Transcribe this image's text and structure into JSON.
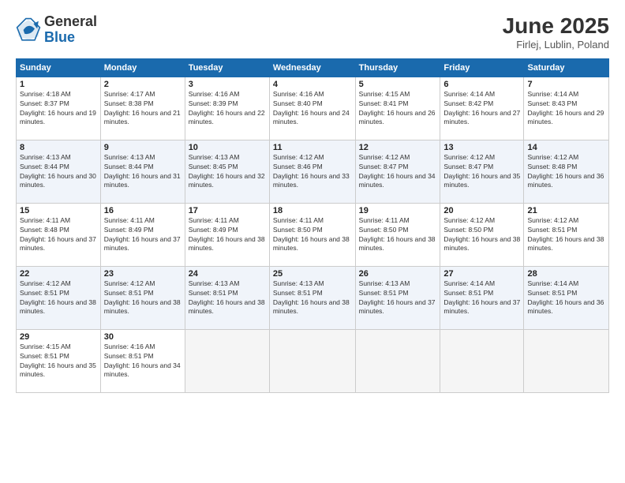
{
  "header": {
    "logo_general": "General",
    "logo_blue": "Blue",
    "title": "June 2025",
    "subtitle": "Firlej, Lublin, Poland"
  },
  "calendar": {
    "days_of_week": [
      "Sunday",
      "Monday",
      "Tuesday",
      "Wednesday",
      "Thursday",
      "Friday",
      "Saturday"
    ],
    "weeks": [
      [
        {
          "day": "",
          "empty": true
        },
        {
          "day": "",
          "empty": true
        },
        {
          "day": "",
          "empty": true
        },
        {
          "day": "",
          "empty": true
        },
        {
          "day": "",
          "empty": true
        },
        {
          "day": "",
          "empty": true
        },
        {
          "day": "",
          "empty": true
        }
      ],
      [
        {
          "day": "1",
          "sunrise": "4:18 AM",
          "sunset": "8:37 PM",
          "daylight": "16 hours and 19 minutes."
        },
        {
          "day": "2",
          "sunrise": "4:17 AM",
          "sunset": "8:38 PM",
          "daylight": "16 hours and 21 minutes."
        },
        {
          "day": "3",
          "sunrise": "4:16 AM",
          "sunset": "8:39 PM",
          "daylight": "16 hours and 22 minutes."
        },
        {
          "day": "4",
          "sunrise": "4:16 AM",
          "sunset": "8:40 PM",
          "daylight": "16 hours and 24 minutes."
        },
        {
          "day": "5",
          "sunrise": "4:15 AM",
          "sunset": "8:41 PM",
          "daylight": "16 hours and 26 minutes."
        },
        {
          "day": "6",
          "sunrise": "4:14 AM",
          "sunset": "8:42 PM",
          "daylight": "16 hours and 27 minutes."
        },
        {
          "day": "7",
          "sunrise": "4:14 AM",
          "sunset": "8:43 PM",
          "daylight": "16 hours and 29 minutes."
        }
      ],
      [
        {
          "day": "8",
          "sunrise": "4:13 AM",
          "sunset": "8:44 PM",
          "daylight": "16 hours and 30 minutes."
        },
        {
          "day": "9",
          "sunrise": "4:13 AM",
          "sunset": "8:44 PM",
          "daylight": "16 hours and 31 minutes."
        },
        {
          "day": "10",
          "sunrise": "4:13 AM",
          "sunset": "8:45 PM",
          "daylight": "16 hours and 32 minutes."
        },
        {
          "day": "11",
          "sunrise": "4:12 AM",
          "sunset": "8:46 PM",
          "daylight": "16 hours and 33 minutes."
        },
        {
          "day": "12",
          "sunrise": "4:12 AM",
          "sunset": "8:47 PM",
          "daylight": "16 hours and 34 minutes."
        },
        {
          "day": "13",
          "sunrise": "4:12 AM",
          "sunset": "8:47 PM",
          "daylight": "16 hours and 35 minutes."
        },
        {
          "day": "14",
          "sunrise": "4:12 AM",
          "sunset": "8:48 PM",
          "daylight": "16 hours and 36 minutes."
        }
      ],
      [
        {
          "day": "15",
          "sunrise": "4:11 AM",
          "sunset": "8:48 PM",
          "daylight": "16 hours and 37 minutes."
        },
        {
          "day": "16",
          "sunrise": "4:11 AM",
          "sunset": "8:49 PM",
          "daylight": "16 hours and 37 minutes."
        },
        {
          "day": "17",
          "sunrise": "4:11 AM",
          "sunset": "8:49 PM",
          "daylight": "16 hours and 38 minutes."
        },
        {
          "day": "18",
          "sunrise": "4:11 AM",
          "sunset": "8:50 PM",
          "daylight": "16 hours and 38 minutes."
        },
        {
          "day": "19",
          "sunrise": "4:11 AM",
          "sunset": "8:50 PM",
          "daylight": "16 hours and 38 minutes."
        },
        {
          "day": "20",
          "sunrise": "4:12 AM",
          "sunset": "8:50 PM",
          "daylight": "16 hours and 38 minutes."
        },
        {
          "day": "21",
          "sunrise": "4:12 AM",
          "sunset": "8:51 PM",
          "daylight": "16 hours and 38 minutes."
        }
      ],
      [
        {
          "day": "22",
          "sunrise": "4:12 AM",
          "sunset": "8:51 PM",
          "daylight": "16 hours and 38 minutes."
        },
        {
          "day": "23",
          "sunrise": "4:12 AM",
          "sunset": "8:51 PM",
          "daylight": "16 hours and 38 minutes."
        },
        {
          "day": "24",
          "sunrise": "4:13 AM",
          "sunset": "8:51 PM",
          "daylight": "16 hours and 38 minutes."
        },
        {
          "day": "25",
          "sunrise": "4:13 AM",
          "sunset": "8:51 PM",
          "daylight": "16 hours and 38 minutes."
        },
        {
          "day": "26",
          "sunrise": "4:13 AM",
          "sunset": "8:51 PM",
          "daylight": "16 hours and 37 minutes."
        },
        {
          "day": "27",
          "sunrise": "4:14 AM",
          "sunset": "8:51 PM",
          "daylight": "16 hours and 37 minutes."
        },
        {
          "day": "28",
          "sunrise": "4:14 AM",
          "sunset": "8:51 PM",
          "daylight": "16 hours and 36 minutes."
        }
      ],
      [
        {
          "day": "29",
          "sunrise": "4:15 AM",
          "sunset": "8:51 PM",
          "daylight": "16 hours and 35 minutes."
        },
        {
          "day": "30",
          "sunrise": "4:16 AM",
          "sunset": "8:51 PM",
          "daylight": "16 hours and 34 minutes."
        },
        {
          "day": "",
          "empty": true
        },
        {
          "day": "",
          "empty": true
        },
        {
          "day": "",
          "empty": true
        },
        {
          "day": "",
          "empty": true
        },
        {
          "day": "",
          "empty": true
        }
      ]
    ]
  }
}
